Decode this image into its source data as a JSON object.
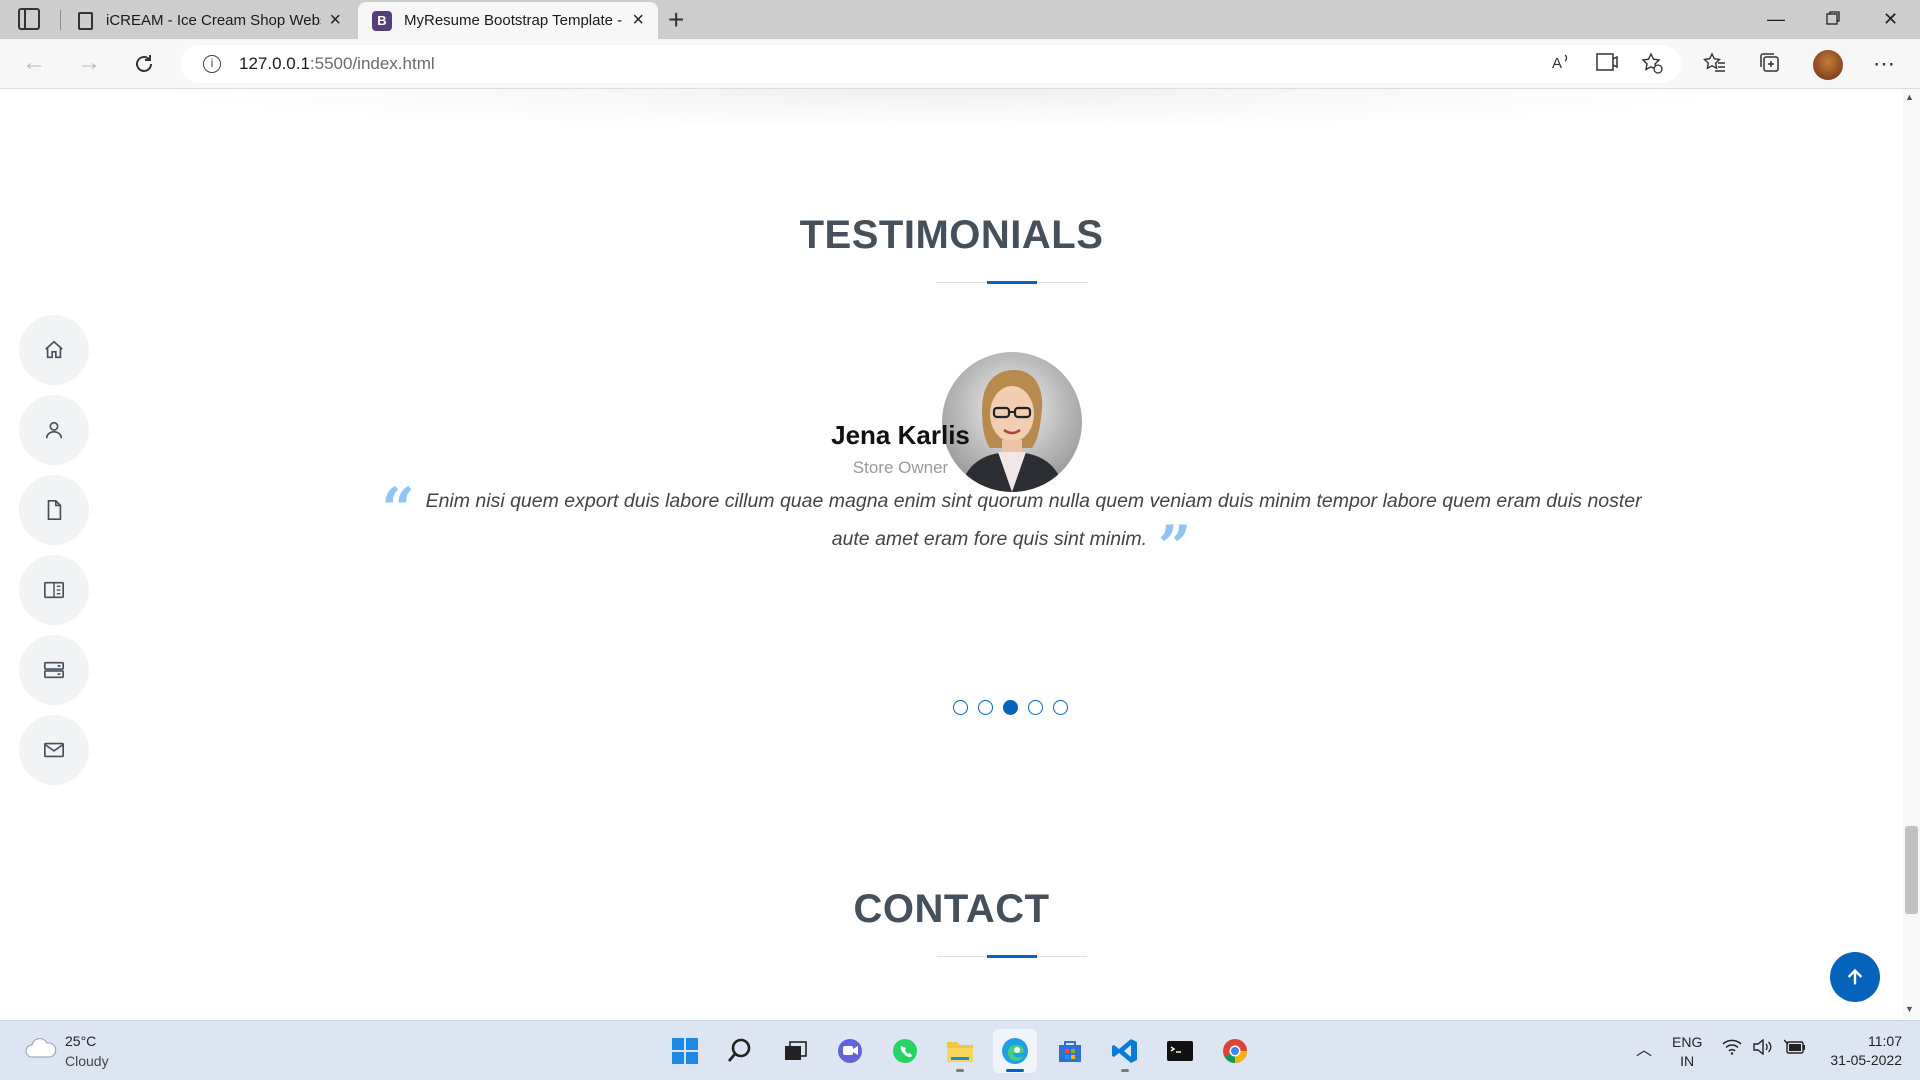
{
  "browser": {
    "tabs": [
      {
        "title": "iCREAM - Ice Cream Shop Websi",
        "active": false
      },
      {
        "title": "MyResume Bootstrap Template -",
        "active": true
      }
    ],
    "favicon_letter": "B",
    "url_host": "127.0.0.1",
    "url_path": ":5500/index.html"
  },
  "sidenav": {
    "items": [
      {
        "icon": "home-icon"
      },
      {
        "icon": "person-icon"
      },
      {
        "icon": "file-icon"
      },
      {
        "icon": "book-icon"
      },
      {
        "icon": "server-icon"
      },
      {
        "icon": "envelope-icon"
      }
    ]
  },
  "testimonials": {
    "title": "TESTIMONIALS",
    "name": "Jena Karlis",
    "role": "Store Owner",
    "quote": "Enim nisi quem export duis labore cillum quae magna enim sint quorum nulla quem veniam duis minim tempor labore quem eram duis noster aute amet eram fore quis sint minim.",
    "slides_total": 5,
    "active_slide": 3
  },
  "contact": {
    "title": "CONTACT"
  },
  "taskbar": {
    "weather_temp": "25°C",
    "weather_desc": "Cloudy",
    "lang_line1": "ENG",
    "lang_line2": "IN",
    "time": "11:07",
    "date": "31-05-2022"
  },
  "colors": {
    "accent": "#0563bb",
    "heading": "#45505b",
    "quote": "#8fc4f5"
  }
}
